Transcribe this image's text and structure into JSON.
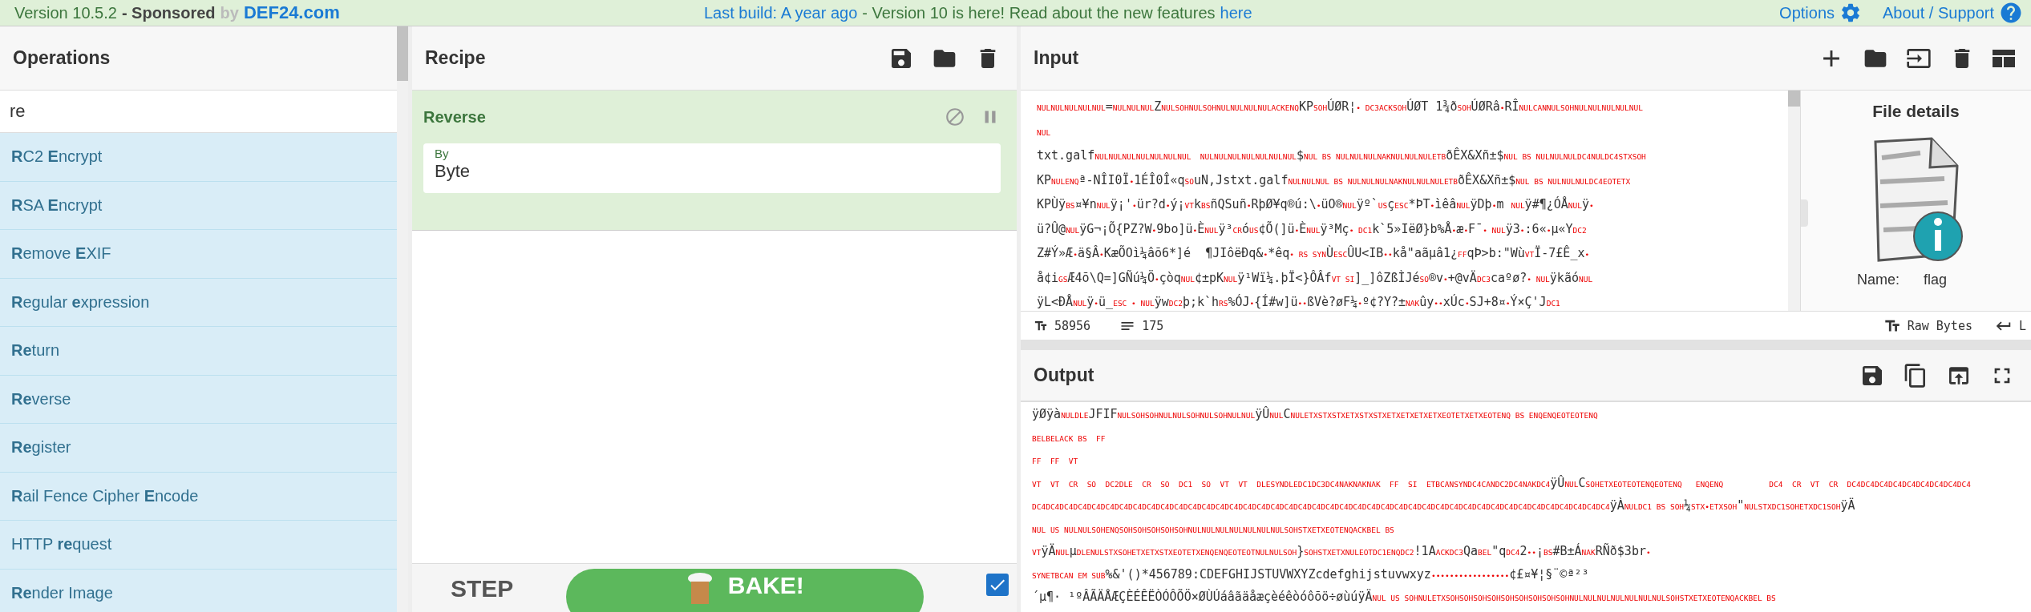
{
  "top_bar": {
    "version": "Version 10.5.2",
    "sponsored": "- Sponsored",
    "by": "by",
    "sponsor": "DEF24.com",
    "build": "Last build: A year ago",
    "notice": "- Version 10 is here! Read about the new features",
    "notice_link": "here",
    "options": "Options",
    "about": "About / Support"
  },
  "operations": {
    "title": "Operations",
    "search": {
      "value": "re"
    },
    "items": [
      "**R**C2 **E**ncrypt",
      "**R**SA **E**ncrypt",
      "**R**emove **E**XIF",
      "**R**egular **e**xpression",
      "**Re**turn",
      "**Re**verse",
      "**Re**gister",
      "**R**ail Fence Cipher **E**ncode",
      "HTTP **re**quest",
      "**Re**nder Image"
    ]
  },
  "recipe": {
    "title": "Recipe",
    "steps": [
      {
        "name": "Reverse",
        "disabled": false,
        "breakpoint": false,
        "args": [
          {
            "label": "By",
            "value": "Byte"
          }
        ]
      }
    ],
    "step_button": "STEP",
    "bake_button": "BAKE!",
    "auto_bake": {
      "checked": true
    }
  },
  "input": {
    "title": "Input",
    "lines": [
      [
        {
          "kind": "ctrl",
          "text": "NULNULNULNULNUL"
        },
        {
          "kind": "text",
          "text": "="
        },
        {
          "kind": "ctrl",
          "text": "NULNULNUL"
        },
        {
          "kind": "text",
          "text": "Z"
        },
        {
          "kind": "ctrl",
          "text": "NULSOHNULSOHNULNULNULNULACKENQ"
        },
        {
          "kind": "text",
          "text": "KP"
        },
        {
          "kind": "ctrl",
          "text": "SOH"
        },
        {
          "kind": "text",
          "text": "ÚØR¦"
        },
        {
          "kind": "ctrl",
          "text": "• DC3ACKSOH"
        },
        {
          "kind": "text",
          "text": "ÚØT 1¾ð"
        },
        {
          "kind": "ctrl",
          "text": "SOH"
        },
        {
          "kind": "text",
          "text": "ÚØRâ"
        },
        {
          "kind": "ctrl",
          "text": "•"
        },
        {
          "kind": "text",
          "text": "RÎ"
        },
        {
          "kind": "ctrl",
          "text": "NULCANNULSOHNULNULNULNULNUL"
        }
      ],
      [
        {
          "kind": "ctrl",
          "text": "NUL"
        }
      ],
      [
        {
          "kind": "text",
          "text": "txt.galf"
        },
        {
          "kind": "ctrl",
          "text": "NULNULNULNULNULNULNUL  NULNULNULNULNULNULNUL"
        },
        {
          "kind": "text",
          "text": "$"
        },
        {
          "kind": "ctrl",
          "text": "NUL BS NULNULNULNAKNULNULNULETB"
        },
        {
          "kind": "text",
          "text": "ðÊX&Xñ±$"
        },
        {
          "kind": "ctrl",
          "text": "NUL BS NULNULNULDC4NULDC4STXSOH"
        }
      ],
      [
        {
          "kind": "text",
          "text": "KP"
        },
        {
          "kind": "ctrl",
          "text": "NULENQ"
        },
        {
          "kind": "text",
          "text": "ª-NÎI0Ï"
        },
        {
          "kind": "ctrl",
          "text": "•"
        },
        {
          "kind": "text",
          "text": "1ÉÎ0Î«q"
        },
        {
          "kind": "ctrl",
          "text": "SO"
        },
        {
          "kind": "text",
          "text": "uN,Jstxt.galf"
        },
        {
          "kind": "ctrl",
          "text": "NULNULNUL BS NULNULNULNAKNULNULNULETB"
        },
        {
          "kind": "text",
          "text": "ðÊX&Xñ±$"
        },
        {
          "kind": "ctrl",
          "text": "NUL BS NULNULNULDC4EOTETX"
        }
      ],
      [
        {
          "kind": "text",
          "text": "KPÙÿ"
        },
        {
          "kind": "ctrl",
          "text": "BS"
        },
        {
          "kind": "text",
          "text": "¤¥n"
        },
        {
          "kind": "ctrl",
          "text": "NUL"
        },
        {
          "kind": "text",
          "text": "ÿ¡'"
        },
        {
          "kind": "ctrl",
          "text": "•"
        },
        {
          "kind": "text",
          "text": "ür?d"
        },
        {
          "kind": "ctrl",
          "text": "•"
        },
        {
          "kind": "text",
          "text": "ý¡"
        },
        {
          "kind": "ctrl",
          "text": "VT"
        },
        {
          "kind": "text",
          "text": "k"
        },
        {
          "kind": "ctrl",
          "text": "BS"
        },
        {
          "kind": "text",
          "text": "ñQSuñ"
        },
        {
          "kind": "ctrl",
          "text": "•"
        },
        {
          "kind": "text",
          "text": "RþØ¥q®ú:\\"
        },
        {
          "kind": "ctrl",
          "text": "•"
        },
        {
          "kind": "text",
          "text": "üO®"
        },
        {
          "kind": "ctrl",
          "text": "NUL"
        },
        {
          "kind": "text",
          "text": "ÿº`"
        },
        {
          "kind": "ctrl",
          "text": "US"
        },
        {
          "kind": "text",
          "text": "ç"
        },
        {
          "kind": "ctrl",
          "text": "ESC"
        },
        {
          "kind": "text",
          "text": "*ÞT"
        },
        {
          "kind": "ctrl",
          "text": "•"
        },
        {
          "kind": "text",
          "text": "ìêâ"
        },
        {
          "kind": "ctrl",
          "text": "NUL"
        },
        {
          "kind": "text",
          "text": "ÿDþ"
        },
        {
          "kind": "ctrl",
          "text": "•"
        },
        {
          "kind": "text",
          "text": "m "
        },
        {
          "kind": "ctrl",
          "text": "NUL"
        },
        {
          "kind": "text",
          "text": "ÿ#¶¿ÓÅ"
        },
        {
          "kind": "ctrl",
          "text": "NUL"
        },
        {
          "kind": "text",
          "text": "ÿ"
        },
        {
          "kind": "ctrl",
          "text": "•"
        }
      ],
      [
        {
          "kind": "text",
          "text": "ü?Û@"
        },
        {
          "kind": "ctrl",
          "text": "NUL"
        },
        {
          "kind": "text",
          "text": "ÿG¬¡Õ{PZ?W"
        },
        {
          "kind": "ctrl",
          "text": "•"
        },
        {
          "kind": "text",
          "text": "9bo]ü"
        },
        {
          "kind": "ctrl",
          "text": "•"
        },
        {
          "kind": "text",
          "text": "È"
        },
        {
          "kind": "ctrl",
          "text": "NUL"
        },
        {
          "kind": "text",
          "text": "ÿ³"
        },
        {
          "kind": "ctrl",
          "text": "CR"
        },
        {
          "kind": "text",
          "text": "ó"
        },
        {
          "kind": "ctrl",
          "text": "US"
        },
        {
          "kind": "text",
          "text": "¢Õ(]ü"
        },
        {
          "kind": "ctrl",
          "text": "•"
        },
        {
          "kind": "text",
          "text": "È"
        },
        {
          "kind": "ctrl",
          "text": "NUL"
        },
        {
          "kind": "text",
          "text": "ÿ³Mç"
        },
        {
          "kind": "ctrl",
          "text": "• DC1"
        },
        {
          "kind": "text",
          "text": "k`5»IëØ}b%Å"
        },
        {
          "kind": "ctrl",
          "text": "•"
        },
        {
          "kind": "text",
          "text": "æ"
        },
        {
          "kind": "ctrl",
          "text": "•"
        },
        {
          "kind": "text",
          "text": "F¯"
        },
        {
          "kind": "ctrl",
          "text": "• NUL"
        },
        {
          "kind": "text",
          "text": "ÿ3"
        },
        {
          "kind": "ctrl",
          "text": "•"
        },
        {
          "kind": "text",
          "text": ":6«"
        },
        {
          "kind": "ctrl",
          "text": "•"
        },
        {
          "kind": "text",
          "text": "µ«Y"
        },
        {
          "kind": "ctrl",
          "text": "DC2"
        }
      ],
      [
        {
          "kind": "text",
          "text": "Z#Ý»Æ"
        },
        {
          "kind": "ctrl",
          "text": "•"
        },
        {
          "kind": "text",
          "text": "ä§Â"
        },
        {
          "kind": "ctrl",
          "text": "•"
        },
        {
          "kind": "text",
          "text": "KæÕOì¼âõ6*]é  ¶JIôëÐq&"
        },
        {
          "kind": "ctrl",
          "text": "•"
        },
        {
          "kind": "text",
          "text": "*êq"
        },
        {
          "kind": "ctrl",
          "text": "• RS SYN"
        },
        {
          "kind": "text",
          "text": "Ù"
        },
        {
          "kind": "ctrl",
          "text": "ESC"
        },
        {
          "kind": "text",
          "text": "ÛU<IB"
        },
        {
          "kind": "ctrl",
          "text": "••"
        },
        {
          "kind": "text",
          "text": "kå\"aãµâ1¿"
        },
        {
          "kind": "ctrl",
          "text": "FF"
        },
        {
          "kind": "text",
          "text": "qÞ>b:\"Wù"
        },
        {
          "kind": "ctrl",
          "text": "VT"
        },
        {
          "kind": "text",
          "text": "Ï-7£Ê_x"
        },
        {
          "kind": "ctrl",
          "text": "•"
        }
      ],
      [
        {
          "kind": "text",
          "text": "å¢i"
        },
        {
          "kind": "ctrl",
          "text": "GS"
        },
        {
          "kind": "text",
          "text": "Æ4õ\\Q=]GÑú¼Ö"
        },
        {
          "kind": "ctrl",
          "text": "•"
        },
        {
          "kind": "text",
          "text": "çòq"
        },
        {
          "kind": "ctrl",
          "text": "NUL"
        },
        {
          "kind": "text",
          "text": "¢±pK"
        },
        {
          "kind": "ctrl",
          "text": "NUL"
        },
        {
          "kind": "text",
          "text": "ÿ¹Wï¼.þÏ<}ÔÂf"
        },
        {
          "kind": "ctrl",
          "text": "VT SI"
        },
        {
          "kind": "text",
          "text": "]_]ôZßÌJé"
        },
        {
          "kind": "ctrl",
          "text": "SO"
        },
        {
          "kind": "text",
          "text": "®v"
        },
        {
          "kind": "ctrl",
          "text": "•"
        },
        {
          "kind": "text",
          "text": "+@vÄ"
        },
        {
          "kind": "ctrl",
          "text": "DC3"
        },
        {
          "kind": "text",
          "text": "caºø?"
        },
        {
          "kind": "ctrl",
          "text": "• NUL"
        },
        {
          "kind": "text",
          "text": "ÿkãó"
        },
        {
          "kind": "ctrl",
          "text": "NUL"
        }
      ],
      [
        {
          "kind": "text",
          "text": "ÿL<ÐÅ"
        },
        {
          "kind": "ctrl",
          "text": "NUL"
        },
        {
          "kind": "text",
          "text": "ÿ"
        },
        {
          "kind": "ctrl",
          "text": "•"
        },
        {
          "kind": "text",
          "text": "ü_"
        },
        {
          "kind": "ctrl",
          "text": "ESC • NUL"
        },
        {
          "kind": "text",
          "text": "ÿw"
        },
        {
          "kind": "ctrl",
          "text": "DC2"
        },
        {
          "kind": "text",
          "text": "þ;k`h"
        },
        {
          "kind": "ctrl",
          "text": "RS"
        },
        {
          "kind": "text",
          "text": "%ÓJ"
        },
        {
          "kind": "ctrl",
          "text": "•"
        },
        {
          "kind": "text",
          "text": "{Í#w]ü"
        },
        {
          "kind": "ctrl",
          "text": "••"
        },
        {
          "kind": "text",
          "text": "ßVè?øF¼"
        },
        {
          "kind": "ctrl",
          "text": "•"
        },
        {
          "kind": "text",
          "text": "º¢?Y?±"
        },
        {
          "kind": "ctrl",
          "text": "NAK"
        },
        {
          "kind": "text",
          "text": "ûy"
        },
        {
          "kind": "ctrl",
          "text": "••"
        },
        {
          "kind": "text",
          "text": "xÚc"
        },
        {
          "kind": "ctrl",
          "text": "•"
        },
        {
          "kind": "text",
          "text": "SJ+8¤"
        },
        {
          "kind": "ctrl",
          "text": "•"
        },
        {
          "kind": "text",
          "text": "Ý×Ç'J"
        },
        {
          "kind": "ctrl",
          "text": "DC1"
        }
      ]
    ],
    "length": "58956",
    "line_count": "175",
    "format": "Raw Bytes",
    "eol": "L",
    "file_details": {
      "title": "File details",
      "name_label": "Name:",
      "name": "flag"
    }
  },
  "output": {
    "title": "Output",
    "lines": [
      [
        {
          "kind": "text",
          "text": "ÿØÿà"
        },
        {
          "kind": "ctrl",
          "text": "NULDLE"
        },
        {
          "kind": "text",
          "text": "JFIF"
        },
        {
          "kind": "ctrl",
          "text": "NULSOHSOHNULNULSOHNULSOHNULNUL"
        },
        {
          "kind": "text",
          "text": "ÿÛ"
        },
        {
          "kind": "ctrl",
          "text": "NUL"
        },
        {
          "kind": "text",
          "text": "C"
        },
        {
          "kind": "ctrl",
          "text": "NULETXSTXSTXETXSTXSTXETXETXETXETXEOTETXETXEOTENQ BS ENQENQEOTEOTENQ"
        }
      ],
      [
        {
          "kind": "ctrl",
          "text": "BELBELACK BS  FF"
        }
      ],
      [
        {
          "kind": "ctrl",
          "text": "FF  FF  VT"
        }
      ],
      [
        {
          "kind": "ctrl",
          "text": "VT  VT  CR  SO  DC2DLE  CR  SO  DC1  SO  VT  VT  DLESYNDLEDC1DC3DC4NAKNAKNAK  FF  SI  ETBCANSYNDC4CANDC2DC4NAKDC4"
        },
        {
          "kind": "text",
          "text": "ÿÛ"
        },
        {
          "kind": "ctrl",
          "text": "NUL"
        },
        {
          "kind": "text",
          "text": "C"
        },
        {
          "kind": "ctrl",
          "text": "SOHETXEOTEOTENQEOTENQ   ENQENQ          DC4  CR  VT  CR  DC4DC4DC4DC4DC4DC4DC4DC4DC4"
        }
      ],
      [
        {
          "kind": "ctrl",
          "text": "DC4DC4DC4DC4DC4DC4DC4DC4DC4DC4DC4DC4DC4DC4DC4DC4DC4DC4DC4DC4DC4DC4DC4DC4DC4DC4DC4DC4DC4DC4DC4DC4DC4DC4DC4DC4DC4DC4DC4DC4DC4DC4"
        },
        {
          "kind": "text",
          "text": "ÿÀ"
        },
        {
          "kind": "ctrl",
          "text": "NULDC1 BS SOH"
        },
        {
          "kind": "text",
          "text": "¼"
        },
        {
          "kind": "ctrl",
          "text": "STX•ETXSOH"
        },
        {
          "kind": "text",
          "text": "\""
        },
        {
          "kind": "ctrl",
          "text": "NULSTXDC1SOHETXDC1SOH"
        },
        {
          "kind": "text",
          "text": "ÿÄ"
        }
      ],
      [
        {
          "kind": "ctrl",
          "text": "NUL US NULNULSOHENQSOHSOHSOHSOHSOHNULNULNULNULNULNULNULSOHSTXETXEOTENQACKBEL BS"
        }
      ],
      [
        {
          "kind": "ctrl",
          "text": "VT"
        },
        {
          "kind": "text",
          "text": "ÿÄ"
        },
        {
          "kind": "ctrl",
          "text": "NUL"
        },
        {
          "kind": "text",
          "text": "µ"
        },
        {
          "kind": "ctrl",
          "text": "DLENULSTXSOHETXETXSTXEOTETXENQENQEOTEOTNULNULSOH"
        },
        {
          "kind": "text",
          "text": "}"
        },
        {
          "kind": "ctrl",
          "text": "SOHSTXETXNULEOTDC1ENQDC2"
        },
        {
          "kind": "text",
          "text": "!1A"
        },
        {
          "kind": "ctrl",
          "text": "ACKDC3"
        },
        {
          "kind": "text",
          "text": "Qa"
        },
        {
          "kind": "ctrl",
          "text": "BEL"
        },
        {
          "kind": "text",
          "text": "\"q"
        },
        {
          "kind": "ctrl",
          "text": "DC4"
        },
        {
          "kind": "text",
          "text": "2"
        },
        {
          "kind": "ctrl",
          "text": "••"
        },
        {
          "kind": "text",
          "text": "¡"
        },
        {
          "kind": "ctrl",
          "text": "BS"
        },
        {
          "kind": "text",
          "text": "#B±Á"
        },
        {
          "kind": "ctrl",
          "text": "NAK"
        },
        {
          "kind": "text",
          "text": "RÑð$3br"
        },
        {
          "kind": "ctrl",
          "text": "•"
        }
      ],
      [
        {
          "kind": "ctrl",
          "text": "SYNETBCAN EM SUB"
        },
        {
          "kind": "text",
          "text": "%&'()*456789:CDEFGHIJSTUVWXYZcdefghijstuvwxyz"
        },
        {
          "kind": "ctrl",
          "text": "•••••••••••••••••"
        },
        {
          "kind": "text",
          "text": "¢£¤¥¦§¨©ª²³"
        }
      ],
      [
        {
          "kind": "text",
          "text": "´µ¶· ¹ºÂÃÄÅÆÇÈÉÊËÒÓÔÕÖ×ØÙÚáâãäåæçèéêòóôõö÷øùúÿÄ"
        },
        {
          "kind": "ctrl",
          "text": "NUL US SOHNULETXSOHSOHSOHSOHSOHSOHSOHSOHSOHNULNULNULNULNULNULNULSOHSTXETXEOTENQACKBEL BS"
        }
      ]
    ]
  }
}
